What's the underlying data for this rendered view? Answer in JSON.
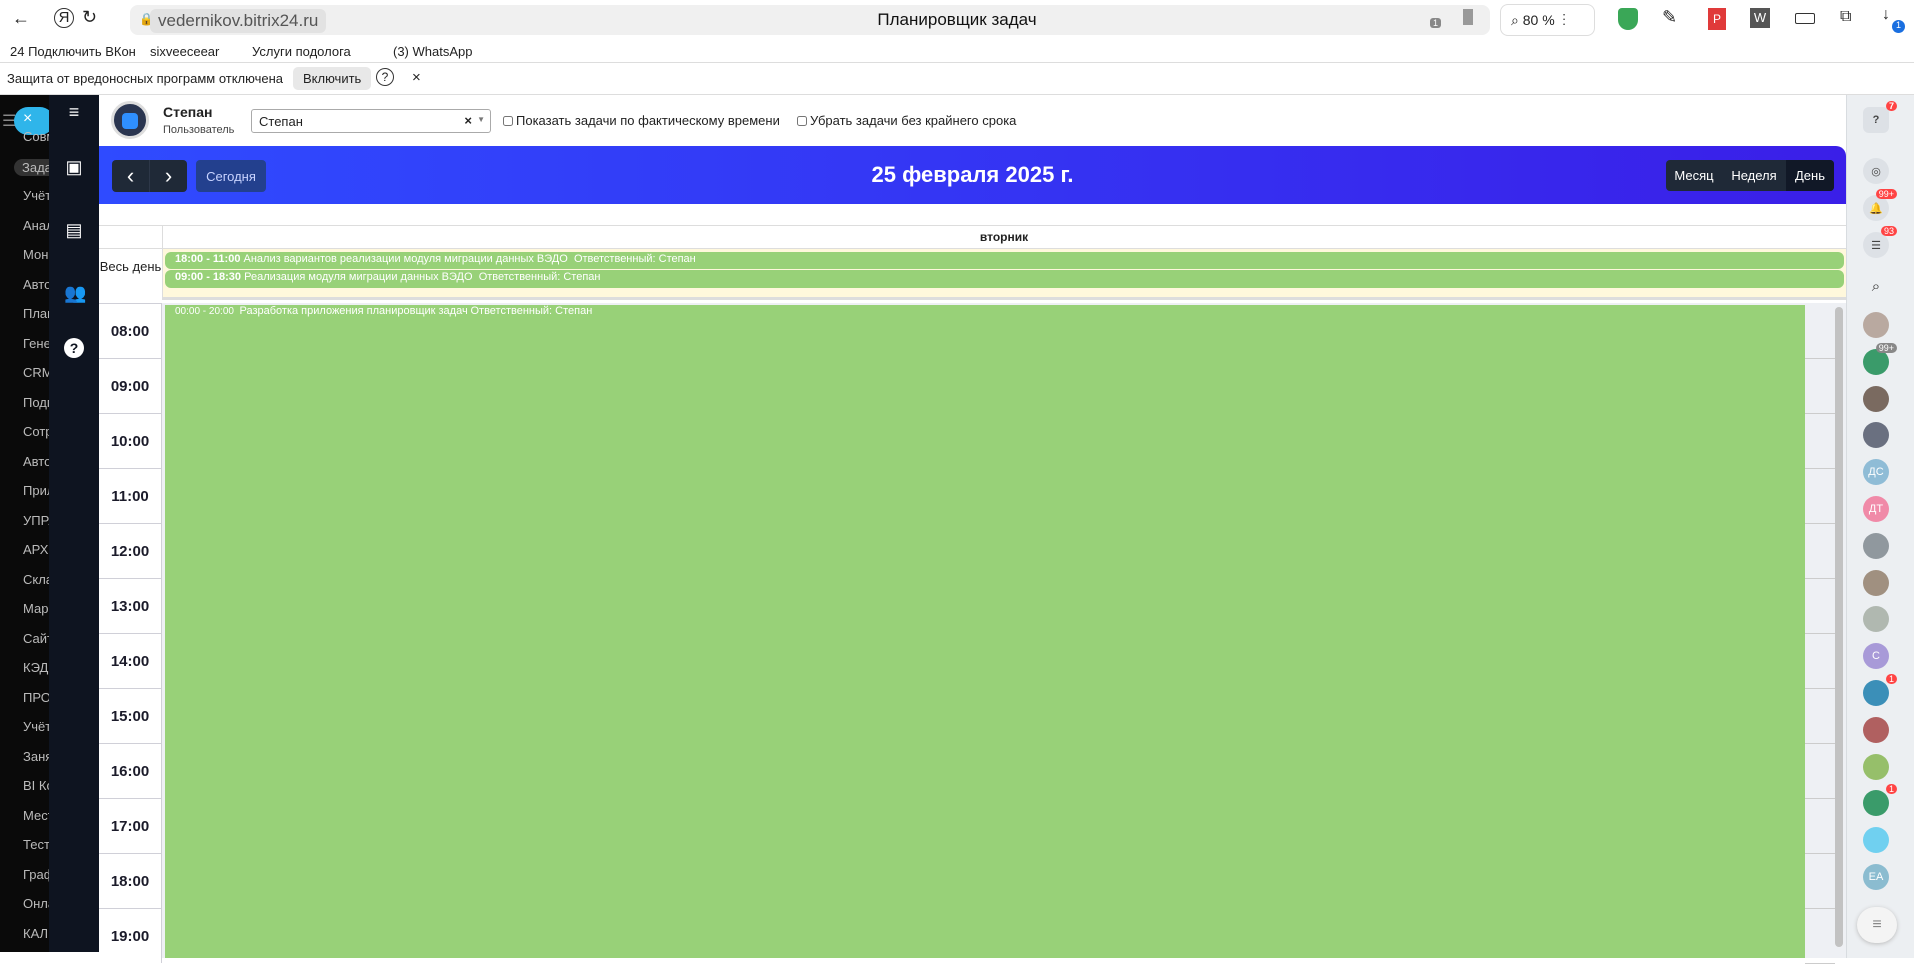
{
  "browser": {
    "url": "vedernikov.bitrix24.ru",
    "title": "Планировщик задач",
    "zoom": "80 %",
    "shield_badge": "1",
    "download_badge": "1",
    "bookmarks": [
      "24 Подключить ВКон",
      "sixveeceear",
      "Услуги подолога",
      "(3) WhatsApp"
    ],
    "infobar": {
      "text": "Защита от вредоносных программ отключена",
      "button": "Включить",
      "help": "?",
      "close": "×"
    }
  },
  "menu": [
    "Совм",
    "Зада",
    "Учёт",
    "Анал",
    "Мон",
    "Авто",
    "План",
    "Гене",
    "CRM",
    "Подп",
    "Сотр",
    "Авто",
    "Прил",
    "УПРА",
    "АРХИ",
    "Скла",
    "Мар",
    "Сайт",
    "КЭД",
    "ПРО",
    "Учёт",
    "Заня",
    "BI Ко",
    "Мест",
    "Тест",
    "Граф",
    "Онла",
    "КАЛ"
  ],
  "user": {
    "name": "Степан",
    "role": "Пользователь",
    "select_value": "Степан",
    "select_clear": "×"
  },
  "filters": [
    {
      "label": "Показать задачи по фактическому времени",
      "checked": false
    },
    {
      "label": "Убрать задачи без крайнего срока",
      "checked": false
    }
  ],
  "toolbar": {
    "prev": "‹",
    "next": "›",
    "today": "Сегодня",
    "date": "25 февраля 2025 г.",
    "views": [
      "Месяц",
      "Неделя",
      "День"
    ],
    "active_view": "День"
  },
  "calendar": {
    "day_name": "вторник",
    "allday_label": "Весь день",
    "allday_events": [
      {
        "time": "18:00 - 11:00",
        "title": "Анализ вариантов реализации модуля миграции данных ВЭДО",
        "resp": "Ответственный: Степан"
      },
      {
        "time": "09:00 - 18:30",
        "title": "Реализация модуля миграции данных ВЭДО",
        "resp": "Ответственный: Степан"
      }
    ],
    "hours": [
      "08:00",
      "09:00",
      "10:00",
      "11:00",
      "12:00",
      "13:00",
      "14:00",
      "15:00",
      "16:00",
      "17:00",
      "18:00",
      "19:00"
    ],
    "timed_event": {
      "time": "00:00 - 20:00",
      "title": "Разработка приложения планировщик задач",
      "resp": "Ответственный: Степан"
    },
    "event_color": "#98d178"
  },
  "right_sidebar": {
    "help_badge": "7",
    "notif_badge": "99+",
    "chat_badge": "93",
    "avatars": [
      {
        "t": "",
        "c": "#b9a9a0"
      },
      {
        "t": "",
        "c": "#3a9b6a",
        "b": "99+"
      },
      {
        "t": "",
        "c": "#7a6a60"
      },
      {
        "t": "",
        "c": "#6a7080"
      },
      {
        "t": "ДС",
        "c": "#8fbcd6"
      },
      {
        "t": "ДТ",
        "c": "#f08aa8"
      },
      {
        "t": "",
        "c": "#90989e"
      },
      {
        "t": "",
        "c": "#a09080"
      },
      {
        "t": "",
        "c": "#b0b8b0"
      },
      {
        "t": "С",
        "c": "#a89ad8"
      },
      {
        "t": "",
        "c": "#3b8fb8",
        "b": "1"
      },
      {
        "t": "",
        "c": "#b06060"
      },
      {
        "t": "",
        "c": "#96bf6a"
      },
      {
        "t": "",
        "c": "#3a9b6a",
        "b": "1"
      },
      {
        "t": "",
        "c": "#70d0f0"
      },
      {
        "t": "ЕА",
        "c": "#8bbcd0"
      }
    ]
  }
}
